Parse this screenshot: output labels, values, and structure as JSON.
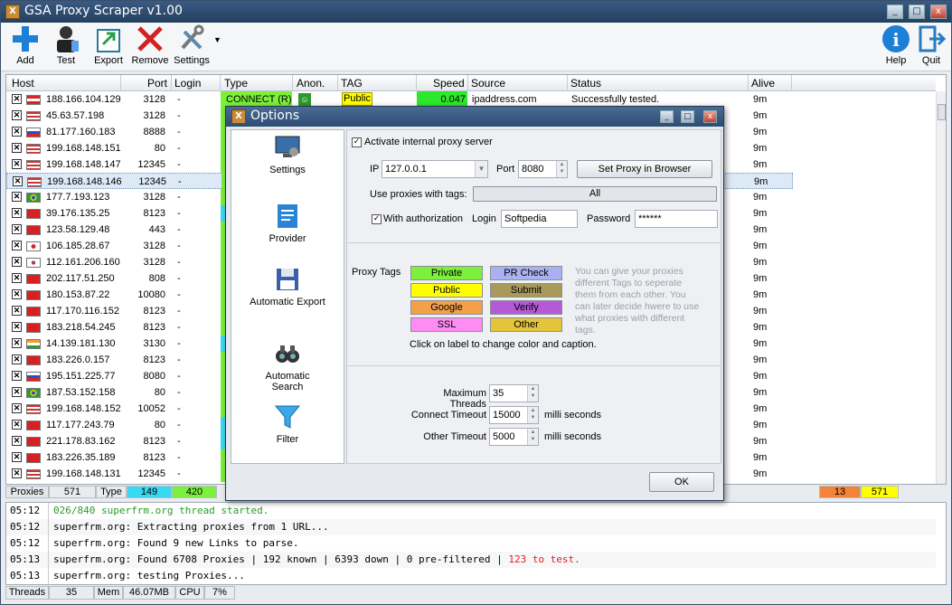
{
  "app": {
    "title": "GSA Proxy Scraper v1.00"
  },
  "toolbar": {
    "add": "Add",
    "test": "Test",
    "export": "Export",
    "remove": "Remove",
    "settings": "Settings",
    "help": "Help",
    "quit": "Quit"
  },
  "columns": [
    "Host",
    "Port",
    "Login",
    "Type",
    "Anon.",
    "TAG",
    "Speed",
    "Source",
    "Status",
    "Alive"
  ],
  "rows": [
    {
      "host": "188.166.104.129",
      "port": "3128",
      "login": "-",
      "alive": "9m",
      "type": "CONNECT (R)",
      "tag": "Public",
      "speed": "0.047",
      "source": "ipaddress.com",
      "status": "Successfully tested."
    },
    {
      "host": "45.63.57.198",
      "port": "3128",
      "login": "-",
      "alive": "9m"
    },
    {
      "host": "81.177.160.183",
      "port": "8888",
      "login": "-",
      "alive": "9m"
    },
    {
      "host": "199.168.148.151",
      "port": "80",
      "login": "-",
      "alive": "9m"
    },
    {
      "host": "199.168.148.147",
      "port": "12345",
      "login": "-",
      "alive": "9m"
    },
    {
      "host": "199.168.148.146",
      "port": "12345",
      "login": "-",
      "alive": "9m"
    },
    {
      "host": "177.7.193.123",
      "port": "3128",
      "login": "-",
      "alive": "9m"
    },
    {
      "host": "39.176.135.25",
      "port": "8123",
      "login": "-",
      "alive": "9m"
    },
    {
      "host": "123.58.129.48",
      "port": "443",
      "login": "-",
      "alive": "9m"
    },
    {
      "host": "106.185.28.67",
      "port": "3128",
      "login": "-",
      "alive": "9m"
    },
    {
      "host": "112.161.206.160",
      "port": "3128",
      "login": "-",
      "alive": "9m"
    },
    {
      "host": "202.117.51.250",
      "port": "808",
      "login": "-",
      "alive": "9m"
    },
    {
      "host": "180.153.87.22",
      "port": "10080",
      "login": "-",
      "alive": "9m"
    },
    {
      "host": "117.170.116.152",
      "port": "8123",
      "login": "-",
      "alive": "9m"
    },
    {
      "host": "183.218.54.245",
      "port": "8123",
      "login": "-",
      "alive": "9m"
    },
    {
      "host": "14.139.181.130",
      "port": "3130",
      "login": "-",
      "alive": "9m"
    },
    {
      "host": "183.226.0.157",
      "port": "8123",
      "login": "-",
      "alive": "9m"
    },
    {
      "host": "195.151.225.77",
      "port": "8080",
      "login": "-",
      "alive": "9m"
    },
    {
      "host": "187.53.152.158",
      "port": "80",
      "login": "-",
      "alive": "9m"
    },
    {
      "host": "199.168.148.152",
      "port": "10052",
      "login": "-",
      "alive": "9m"
    },
    {
      "host": "117.177.243.79",
      "port": "80",
      "login": "-",
      "alive": "9m"
    },
    {
      "host": "221.178.83.162",
      "port": "8123",
      "login": "-",
      "alive": "9m"
    },
    {
      "host": "183.226.35.189",
      "port": "8123",
      "login": "-",
      "alive": "9m"
    },
    {
      "host": "199.168.148.131",
      "port": "12345",
      "login": "-",
      "alive": "9m"
    }
  ],
  "status": {
    "proxies_label": "Proxies",
    "proxies": "571",
    "type_label": "Type",
    "type_a": "149",
    "type_b": "420",
    "right_a": "13",
    "right_b": "571"
  },
  "log": [
    {
      "time": "05:12",
      "msg": "026/840 superfrm.org thread started.",
      "color": "#2a9a2a"
    },
    {
      "time": "05:12",
      "msg": "superfrm.org: Extracting proxies from 1 URL..."
    },
    {
      "time": "05:12",
      "msg": "superfrm.org: Found 9 new Links to parse."
    },
    {
      "time": "05:13",
      "msg": "superfrm.org: Found 6708 Proxies | 192 known | 6393 down | 0 pre-filtered | ",
      "tail": "123 to test."
    },
    {
      "time": "05:13",
      "msg": "superfrm.org: testing Proxies..."
    }
  ],
  "bottom": {
    "threads_label": "Threads",
    "threads": "35",
    "mem_label": "Mem",
    "mem": "46.07MB",
    "cpu_label": "CPU",
    "cpu": "7%"
  },
  "dialog": {
    "title": "Options",
    "side": [
      "Settings",
      "Provider",
      "Automatic Export",
      "Automatic Search",
      "Filter"
    ],
    "activate": "Activate internal proxy server",
    "ip_label": "IP",
    "ip": "127.0.0.1",
    "port_label": "Port",
    "port": "8080",
    "set_proxy": "Set Proxy in Browser",
    "use_tags_label": "Use proxies with tags:",
    "use_tags": "All",
    "with_auth": "With authorization",
    "login_label": "Login",
    "login": "Softpedia",
    "password_label": "Password",
    "password": "******",
    "proxy_tags_label": "Proxy Tags",
    "tags": [
      {
        "label": "Private",
        "color": "#7cf03a"
      },
      {
        "label": "PR Check",
        "color": "#aab1f0"
      },
      {
        "label": "Public",
        "color": "#ffff00"
      },
      {
        "label": "Submit",
        "color": "#a89a5a"
      },
      {
        "label": "Google",
        "color": "#f4a04a"
      },
      {
        "label": "Verify",
        "color": "#b45ad6"
      },
      {
        "label": "SSL",
        "color": "#ff8cf2"
      },
      {
        "label": "Other",
        "color": "#e4c43a"
      }
    ],
    "tags_hint": "You can give your proxies different Tags to seperate them from each other. You can later decide hwere to use what proxies with different tags.",
    "click_hint": "Click on label to change color and caption.",
    "max_threads_label": "Maximum Threads",
    "max_threads": "35",
    "conn_timeout_label": "Connect Timeout",
    "conn_timeout": "15000",
    "other_timeout_label": "Other Timeout",
    "other_timeout": "5000",
    "ms": "milli seconds",
    "ok": "OK"
  }
}
